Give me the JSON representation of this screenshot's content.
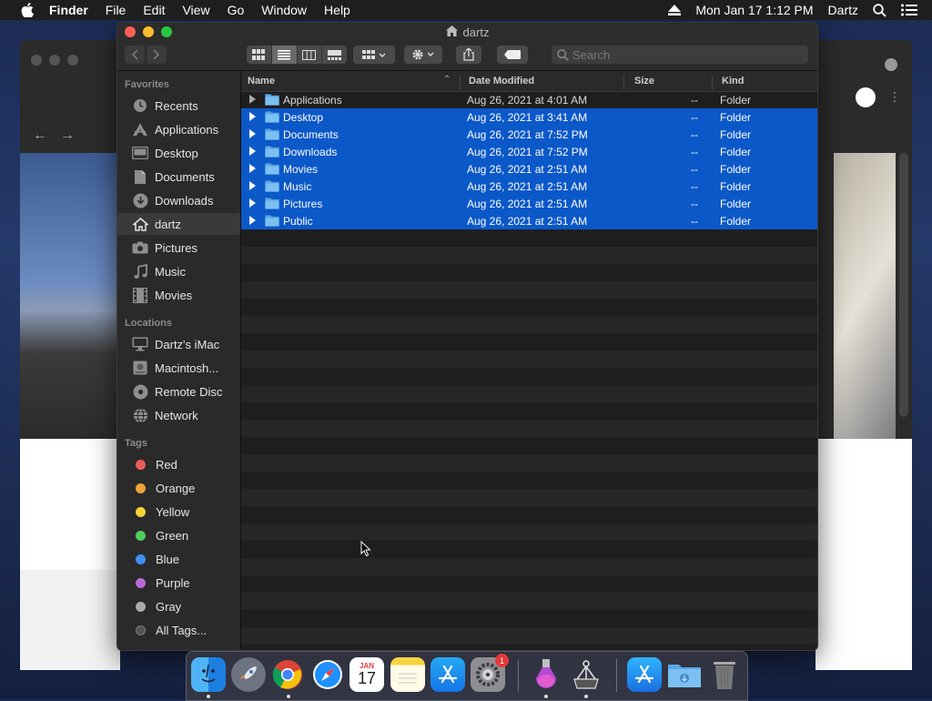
{
  "menubar": {
    "app": "Finder",
    "menus": [
      "File",
      "Edit",
      "View",
      "Go",
      "Window",
      "Help"
    ],
    "datetime": "Mon Jan 17  1:12 PM",
    "user": "Dartz"
  },
  "window": {
    "title": "dartz",
    "search_placeholder": "Search"
  },
  "sidebar": {
    "favorites_header": "Favorites",
    "favorites": [
      {
        "label": "Recents",
        "icon": "clock-icon"
      },
      {
        "label": "Applications",
        "icon": "applications-icon"
      },
      {
        "label": "Desktop",
        "icon": "desktop-icon"
      },
      {
        "label": "Documents",
        "icon": "document-icon"
      },
      {
        "label": "Downloads",
        "icon": "download-icon"
      },
      {
        "label": "dartz",
        "icon": "home-icon",
        "selected": true
      },
      {
        "label": "Pictures",
        "icon": "camera-icon"
      },
      {
        "label": "Music",
        "icon": "music-note-icon"
      },
      {
        "label": "Movies",
        "icon": "film-icon"
      }
    ],
    "locations_header": "Locations",
    "locations": [
      {
        "label": "Dartz's iMac",
        "icon": "imac-icon"
      },
      {
        "label": "Macintosh...",
        "icon": "hard-disk-icon"
      },
      {
        "label": "Remote Disc",
        "icon": "disc-icon"
      },
      {
        "label": "Network",
        "icon": "globe-icon"
      }
    ],
    "tags_header": "Tags",
    "tags": [
      {
        "label": "Red",
        "color": "#ec5b5b"
      },
      {
        "label": "Orange",
        "color": "#f0a23a"
      },
      {
        "label": "Yellow",
        "color": "#f4d43a"
      },
      {
        "label": "Green",
        "color": "#4ccc5b"
      },
      {
        "label": "Blue",
        "color": "#3d8ff0"
      },
      {
        "label": "Purple",
        "color": "#b66ad6"
      },
      {
        "label": "Gray",
        "color": "#a9a9a9"
      },
      {
        "label": "All Tags...",
        "color": "#555555"
      }
    ]
  },
  "columns": {
    "name": "Name",
    "date": "Date Modified",
    "size": "Size",
    "kind": "Kind"
  },
  "files": [
    {
      "name": "Applications",
      "date": "Aug 26, 2021 at 4:01 AM",
      "size": "--",
      "kind": "Folder",
      "selected": false
    },
    {
      "name": "Desktop",
      "date": "Aug 26, 2021 at 3:41 AM",
      "size": "--",
      "kind": "Folder",
      "selected": true
    },
    {
      "name": "Documents",
      "date": "Aug 26, 2021 at 7:52 PM",
      "size": "--",
      "kind": "Folder",
      "selected": true
    },
    {
      "name": "Downloads",
      "date": "Aug 26, 2021 at 7:52 PM",
      "size": "--",
      "kind": "Folder",
      "selected": true
    },
    {
      "name": "Movies",
      "date": "Aug 26, 2021 at 2:51 AM",
      "size": "--",
      "kind": "Folder",
      "selected": true
    },
    {
      "name": "Music",
      "date": "Aug 26, 2021 at 2:51 AM",
      "size": "--",
      "kind": "Folder",
      "selected": true
    },
    {
      "name": "Pictures",
      "date": "Aug 26, 2021 at 2:51 AM",
      "size": "--",
      "kind": "Folder",
      "selected": true
    },
    {
      "name": "Public",
      "date": "Aug 26, 2021 at 2:51 AM",
      "size": "--",
      "kind": "Folder",
      "selected": true
    }
  ],
  "dock": {
    "calendar_month": "JAN",
    "calendar_day": "17",
    "system_prefs_badge": "1"
  },
  "colors": {
    "selection": "#0b58c9",
    "folder": "#5aa7e6"
  }
}
